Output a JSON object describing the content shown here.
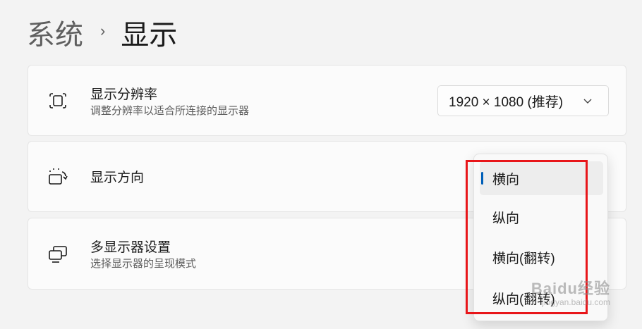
{
  "breadcrumb": {
    "parent": "系统",
    "separator": "›",
    "current": "显示"
  },
  "cards": {
    "resolution": {
      "title": "显示分辨率",
      "subtitle": "调整分辨率以适合所连接的显示器",
      "icon": "resolution-icon",
      "select_value": "1920 × 1080 (推荐)"
    },
    "orientation": {
      "title": "显示方向",
      "icon": "orientation-icon"
    },
    "multi_display": {
      "title": "多显示器设置",
      "subtitle": "选择显示器的呈现模式",
      "icon": "multi-display-icon"
    }
  },
  "orientation_menu": {
    "items": [
      {
        "label": "横向",
        "selected": true
      },
      {
        "label": "纵向",
        "selected": false
      },
      {
        "label": "横向(翻转)",
        "selected": false
      },
      {
        "label": "纵向(翻转)",
        "selected": false
      }
    ]
  },
  "watermark": {
    "main": "Baidu经验",
    "sub": "jingyan.baidu.com"
  },
  "colors": {
    "accent": "#005fb8",
    "highlight": "#e8161a",
    "background": "#f3f3f3",
    "card": "#fbfbfb"
  }
}
